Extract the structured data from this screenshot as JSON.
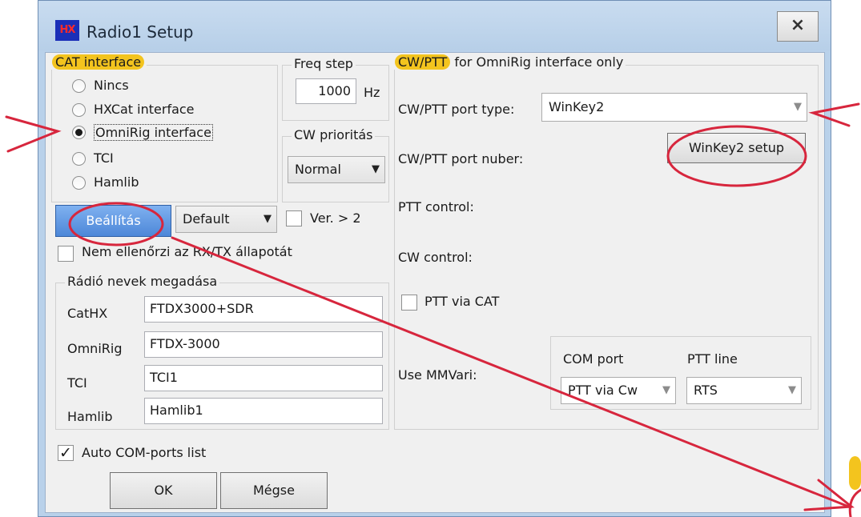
{
  "window": {
    "title": "Radio1 Setup",
    "app_icon_text": "HX",
    "close_label": "×"
  },
  "cat": {
    "legend": "CAT interface",
    "options": [
      "Nincs",
      "HXCat interface",
      "OmniRig interface",
      "TCI",
      "Hamlib"
    ],
    "selected": "OmniRig interface"
  },
  "freq_step": {
    "legend": "Freq step",
    "value": "1000",
    "unit": "Hz"
  },
  "cw_priority": {
    "legend": "CW prioritás",
    "value": "Normal"
  },
  "setup_row": {
    "button": "Beállítás",
    "profile": "Default",
    "ver_label": "Ver. > 2"
  },
  "no_check_label": "Nem ellenőrzi az RX/TX állapotát",
  "radio_names": {
    "legend": "Rádió nevek megadása",
    "rows": [
      {
        "label": "CatHX",
        "value": "FTDX3000+SDR"
      },
      {
        "label": "OmniRig",
        "value": "FTDX-3000"
      },
      {
        "label": "TCI",
        "value": "TCI1"
      },
      {
        "label": "Hamlib",
        "value": "Hamlib1"
      }
    ]
  },
  "auto_com": {
    "label": "Auto COM-ports list",
    "checked": true
  },
  "buttons": {
    "ok": "OK",
    "cancel": "Mégse"
  },
  "cwptt": {
    "legend_hl": "CW/PTT",
    "legend_rest": " for OmniRig interface only",
    "port_type_label": "CW/PTT port type:",
    "port_type_value": "WinKey2",
    "port_number_label": "CW/PTT port nuber:",
    "winkey_button": "WinKey2 setup",
    "ptt_control_label": "PTT control:",
    "cw_control_label": "CW control:",
    "ptt_via_cat_label": "PTT via CAT",
    "use_mmvari_label": "Use MMVari:",
    "com_port_label": "COM port",
    "com_port_value": "PTT via Cw",
    "ptt_line_label": "PTT line",
    "ptt_line_value": "RTS"
  },
  "annotation_colors": {
    "highlight": "#f3c41e",
    "markup": "#d7263d"
  }
}
